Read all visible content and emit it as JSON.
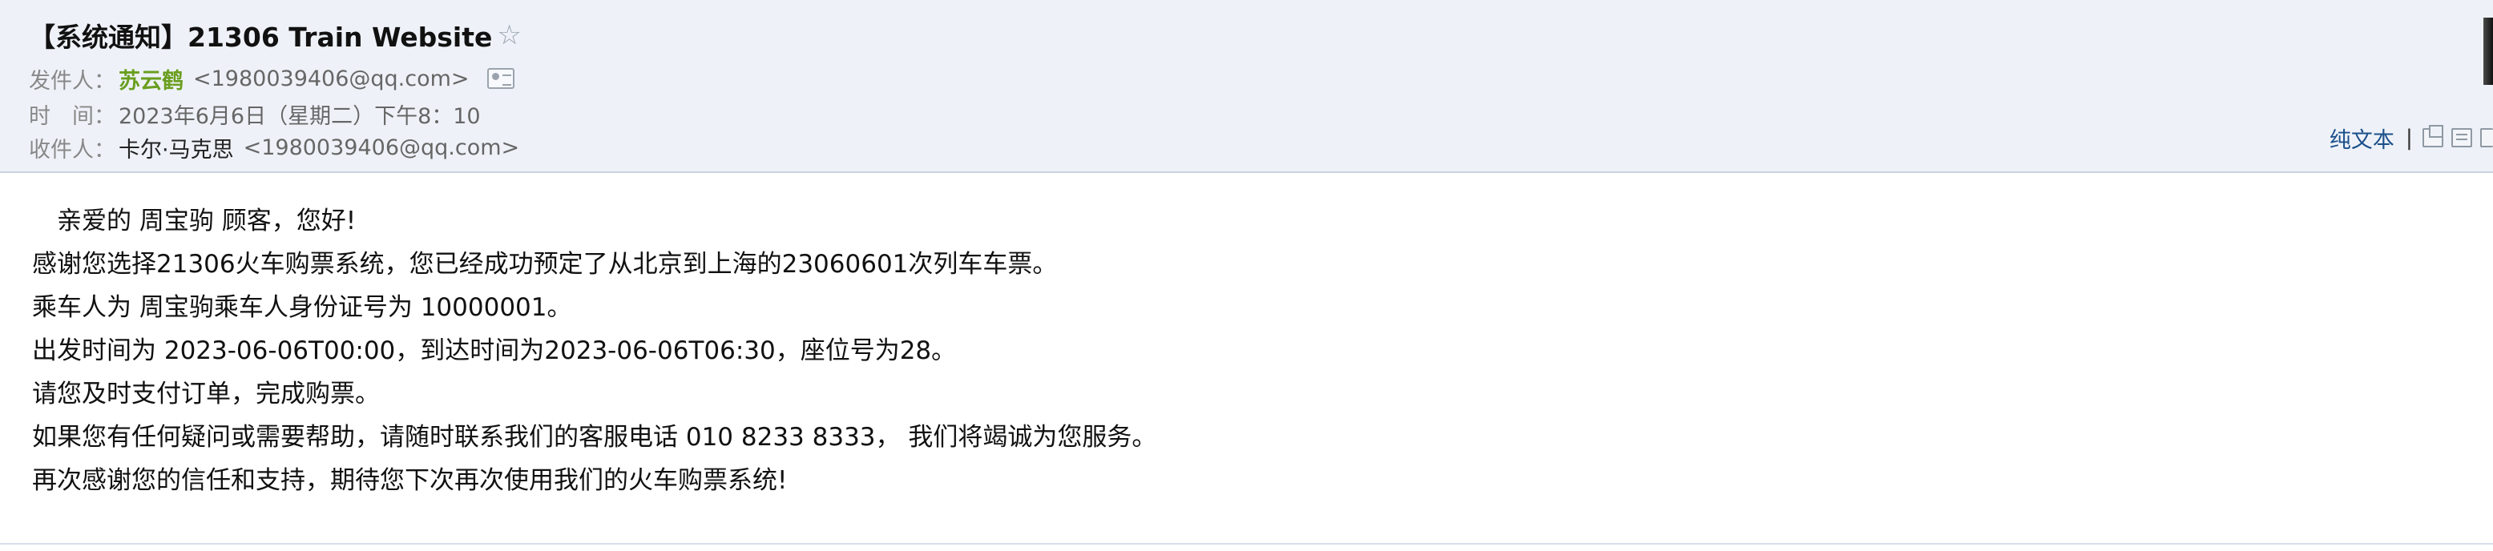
{
  "email": {
    "subject": "【系统通知】21306 Train Website",
    "star_icon": "☆",
    "sender": {
      "label": "发件人：",
      "name": "苏云鹤",
      "address": "<1980039406@qq.com>"
    },
    "time": {
      "label": "时　间：",
      "value": "2023年6月6日（星期二）下午8：10"
    },
    "recipient": {
      "label": "收件人：",
      "name": "卡尔·马克思",
      "address": "<1980039406@qq.com>"
    },
    "toolbar": {
      "plain_text_label": "纯文本",
      "divider": "|",
      "icons": [
        "new-window-icon",
        "print-icon",
        "download-icon"
      ]
    },
    "body_lines": [
      "　亲爱的 周宝驹 顾客，您好!",
      "感谢您选择21306火车购票系统，您已经成功预定了从北京到上海的23060601次列车车票。",
      "乘车人为 周宝驹乘车人身份证号为 10000001。",
      "出发时间为 2023-06-06T00:00，到达时间为2023-06-06T06:30，座位号为28。",
      "请您及时支付订单，完成购票。",
      " 如果您有任何疑问或需要帮助，请随时联系我们的客服电话 010 8233 8333， 我们将竭诚为您服务。",
      "再次感谢您的信任和支持，期待您下次再次使用我们的火车购票系统!"
    ]
  },
  "colors": {
    "header_bg": "#eef2f8",
    "sender_name": "#6a9e1f",
    "link": "#1a4f8a"
  }
}
